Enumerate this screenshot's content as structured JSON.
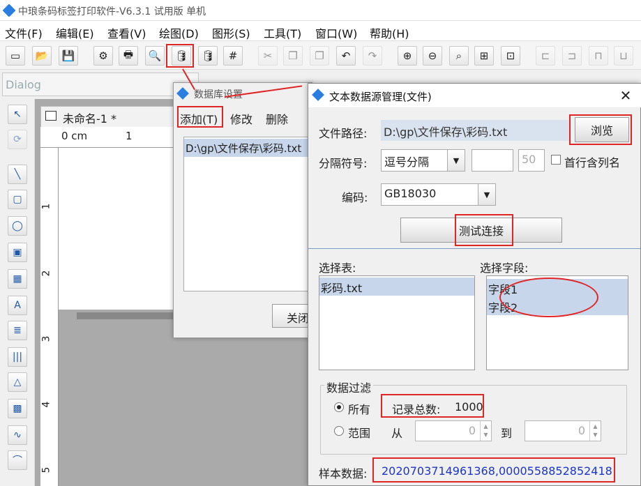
{
  "app": {
    "title": "中琅条码标签打印软件-V6.3.1 试用版 单机",
    "menu": [
      "文件(F)",
      "编辑(E)",
      "查看(V)",
      "绘图(D)",
      "图形(S)",
      "工具(T)",
      "窗口(W)",
      "帮助(H)"
    ],
    "font_combo": "Dialog"
  },
  "toolbar_icons": [
    "window-icon",
    "open-icon",
    "save-icon",
    "settings-icon",
    "print-icon",
    "preview-icon",
    "database-icon",
    "database-link-icon",
    "grid-icon",
    "cut-icon",
    "copy-icon",
    "paste-icon",
    "undo-icon",
    "redo-icon",
    "zoom-in-icon",
    "zoom-out-icon",
    "zoom-icon",
    "fit-page-icon",
    "fit-width-icon",
    "align-icon",
    "align2-icon",
    "group-icon",
    "ungroup-icon"
  ],
  "document": {
    "tab_label": "未命名-1 *",
    "ruler_unit": "0 cm",
    "ruler_h_ticks": [
      "1"
    ],
    "ruler_v_ticks": [
      "1",
      "2",
      "3",
      "4",
      "5"
    ]
  },
  "db_settings": {
    "title": "数据库设置",
    "menu": [
      "添加(T)",
      "修改",
      "删除"
    ],
    "list_item": "D:\\gp\\文件保存\\彩码.txt",
    "close_label": "关闭"
  },
  "text_source": {
    "title": "文本数据源管理(文件)",
    "file_path_label": "文件路径:",
    "file_path_value": "D:\\gp\\文件保存\\彩码.txt",
    "browse_label": "浏览",
    "separator_label": "分隔符号:",
    "separator_value": "逗号分隔",
    "separator_custom": "",
    "separator_num": "50",
    "header_checkbox_label": "首行含列名",
    "encoding_label": "编码:",
    "encoding_value": "GB18030",
    "test_label": "测试连接",
    "table_label": "选择表:",
    "tables": [
      "彩码.txt"
    ],
    "field_label": "选择字段:",
    "fields": [
      "字段1",
      "字段2"
    ],
    "filter_title": "数据过滤",
    "filter_all": "所有",
    "record_total_label": "记录总数:",
    "record_total_value": "1000",
    "filter_range": "范围",
    "from_label": "从",
    "from_value": "0",
    "to_label": "到",
    "to_value": "0",
    "sample_label": "样本数据:",
    "sample_value": "2020703714961368,0000558852852418"
  },
  "colors": {
    "annotation": "#e02525",
    "selection": "#c7d6eb",
    "sample_text": "#1c35c9"
  }
}
